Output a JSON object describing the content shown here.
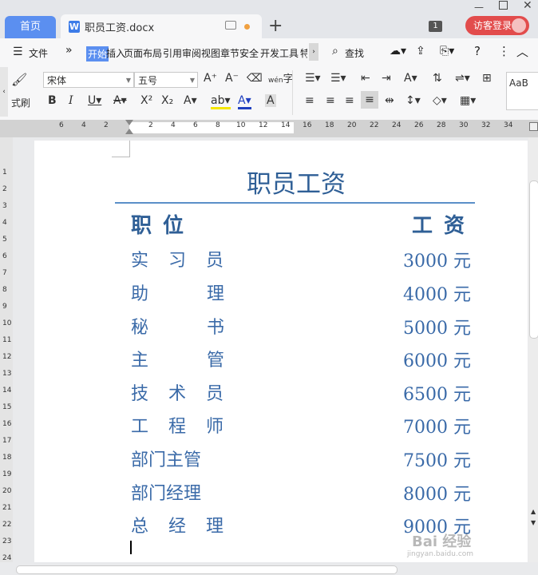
{
  "window": {
    "home_tab": "首页",
    "doc_tab": "职员工资.docx",
    "doc_icon": "W",
    "new_tab": "+",
    "badge": "1",
    "login": "访客登录"
  },
  "menubar": {
    "file": "文件",
    "more": "»",
    "items": [
      "开始",
      "插入",
      "页面布局",
      "引用",
      "审阅",
      "视图",
      "章节",
      "安全",
      "开发工具",
      "特"
    ],
    "search": "查找"
  },
  "ribbon": {
    "format_painter": "式刷",
    "font_name": "宋体",
    "font_size": "五号",
    "pinyin": "wén",
    "style_preview": "AaB"
  },
  "ruler": {
    "h_marks": [
      "6",
      "4",
      "2",
      "2",
      "4",
      "6",
      "8",
      "10",
      "12",
      "14",
      "16",
      "18",
      "20",
      "22",
      "24",
      "26",
      "28",
      "30",
      "32",
      "34"
    ],
    "v_marks": [
      "1",
      "2",
      "3",
      "4",
      "5",
      "6",
      "7",
      "8",
      "9",
      "10",
      "11",
      "12",
      "13",
      "14",
      "15",
      "16",
      "17",
      "18",
      "19",
      "20",
      "21",
      "22",
      "23",
      "24"
    ]
  },
  "document": {
    "title": "职员工资",
    "header_position": "职位",
    "header_salary": "工资",
    "rows": [
      {
        "position": "实 习 员",
        "salary": "3000 元"
      },
      {
        "position": "助    理",
        "salary": "4000 元"
      },
      {
        "position": "秘    书",
        "salary": "5000 元"
      },
      {
        "position": "主    管",
        "salary": "6000 元"
      },
      {
        "position": "技 术 员",
        "salary": "6500 元"
      },
      {
        "position": "工 程 师",
        "salary": "7000 元"
      },
      {
        "position": "部门主管",
        "salary": "7500 元"
      },
      {
        "position": "部门经理",
        "salary": "8000 元"
      },
      {
        "position": "总 经 理",
        "salary": "9000 元"
      }
    ]
  },
  "watermark": {
    "main": "Bai 经验",
    "sub": "jingyan.baidu.com"
  },
  "colors": {
    "accent": "#5b8ff0",
    "doc_text": "#3a6aa8",
    "login": "#e24c4c"
  }
}
